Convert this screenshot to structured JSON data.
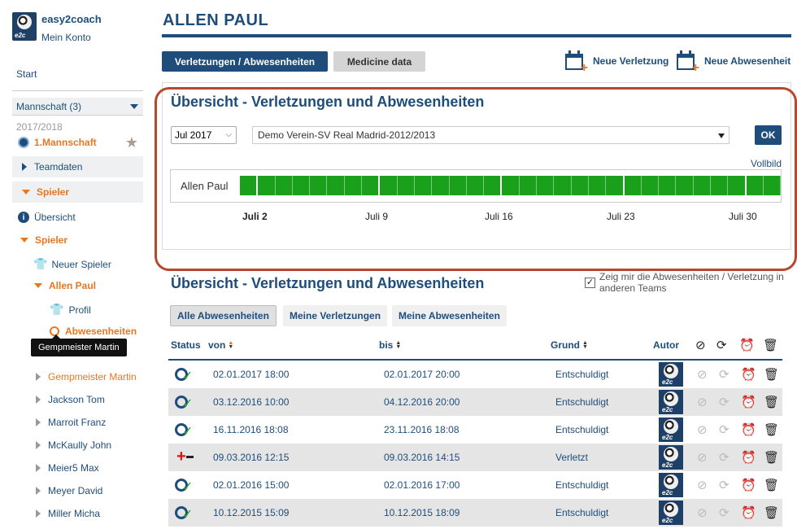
{
  "brand": {
    "name": "easy2coach",
    "account": "Mein Konto",
    "logo_label": "e2c"
  },
  "sidebar": {
    "start": "Start",
    "team_select": "Mannschaft (3)",
    "season": "2017/2018",
    "team": "1.Mannschaft",
    "teamdaten": "Teamdaten",
    "spieler_section": "Spieler",
    "uebersicht": "Übersicht",
    "spieler_sub": "Spieler",
    "neuer_spieler": "Neuer Spieler",
    "current_player": "Allen Paul",
    "profil": "Profil",
    "abwesenheiten": "Abwesenheiten",
    "tooltip": "Gempmeister Martin",
    "players": [
      "Gempmeister Martin",
      "Jackson Tom",
      "Marroit Franz",
      "McKaully John",
      "Meier5 Max",
      "Meyer David",
      "Miller Micha"
    ]
  },
  "header": {
    "title": "ALLEN PAUL"
  },
  "tabs": {
    "active": "Verletzungen / Abwesenheiten",
    "inactive": "Medicine data"
  },
  "actions": {
    "new_injury": "Neue Verletzung",
    "new_absence": "Neue Abwesenheit"
  },
  "overview": {
    "title": "Übersicht - Verletzungen und Abwesenheiten",
    "month": "Jul 2017",
    "club": "Demo Verein-SV Real Madrid-2012/2013",
    "ok": "OK",
    "fullscreen": "Vollbild",
    "player": "Allen Paul",
    "ticks": [
      "Juli 2",
      "Juli 9",
      "Juli 16",
      "Juli 23",
      "Juli 30"
    ]
  },
  "list": {
    "title": "Übersicht - Verletzungen und Abwesenheiten",
    "checkbox_label": "Zeig mir die Abwesenheiten / Verletzung in anderen Teams",
    "filters": [
      "Alle Abwesenheiten",
      "Meine Verletzungen",
      "Meine Abwesenheiten"
    ],
    "columns": {
      "status": "Status",
      "from": "von",
      "to": "bis",
      "reason": "Grund",
      "author": "Autor"
    },
    "rows": [
      {
        "type": "absence",
        "from": "02.01.2017 18:00",
        "to": "02.01.2017 20:00",
        "reason": "Entschuldigt"
      },
      {
        "type": "absence",
        "from": "03.12.2016 10:00",
        "to": "04.12.2016 20:00",
        "reason": "Entschuldigt"
      },
      {
        "type": "absence",
        "from": "16.11.2016 18:08",
        "to": "23.11.2016 18:08",
        "reason": "Entschuldigt"
      },
      {
        "type": "injury",
        "from": "09.03.2016 12:15",
        "to": "09.03.2016 14:15",
        "reason": "Verletzt"
      },
      {
        "type": "absence",
        "from": "02.01.2016 15:00",
        "to": "02.01.2016 17:00",
        "reason": "Entschuldigt"
      },
      {
        "type": "absence",
        "from": "10.12.2015 15:09",
        "to": "10.12.2015 18:09",
        "reason": "Entschuldigt"
      }
    ]
  },
  "colors": {
    "primary": "#1e4d7b",
    "accent": "#e87722",
    "bar": "#1aa01a",
    "highlight": "#b5482e"
  }
}
